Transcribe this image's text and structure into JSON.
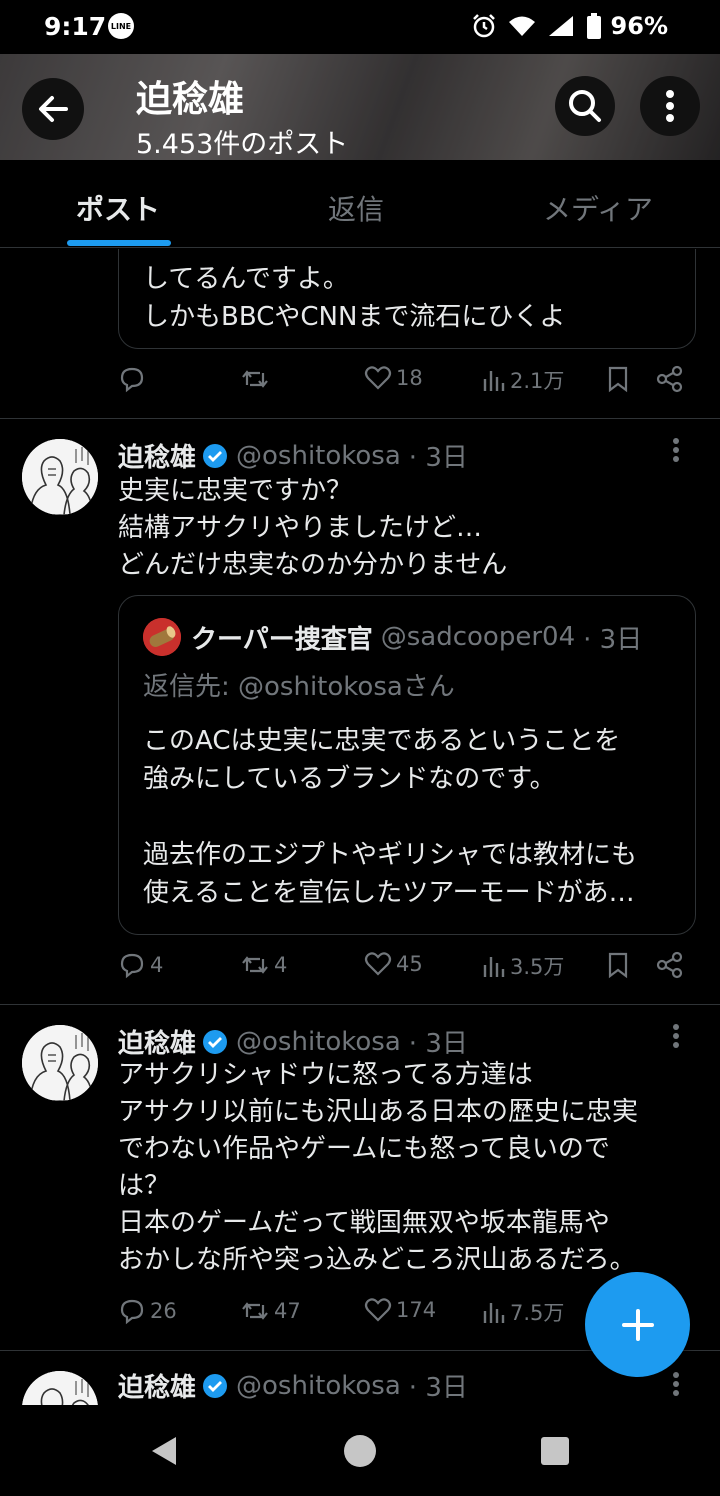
{
  "status_bar": {
    "time": "9:17",
    "line_app": "LINE",
    "battery": "96%"
  },
  "header": {
    "title": "迫稔雄",
    "post_count": "5.453件のポスト"
  },
  "tabs": [
    {
      "label": "ポスト",
      "active": true
    },
    {
      "label": "返信",
      "active": false
    },
    {
      "label": "メディア",
      "active": false
    }
  ],
  "tweets": [
    {
      "quote_tail": "してるんですよ。\nしかもBBCやCNNまで流石にひくよ",
      "actions": {
        "replies": "",
        "retweets": "",
        "likes": "18",
        "views": "2.1万"
      }
    },
    {
      "name": "迫稔雄",
      "handle": "@oshitokosa",
      "time": "· 3日",
      "text": "史実に忠実ですか？\n結構アサクリやりましたけど…\nどんだけ忠実なのか分かりません",
      "quote": {
        "name": "クーパー捜査官",
        "handle": "@sadcooper04",
        "time": "· 3日",
        "reply_to": "返信先: @oshitokosaさん",
        "text": "このACは史実に忠実であるということを\n強みにしているブランドなのです。\n\n過去作のエジプトやギリシャでは教材にも\n使えることを宣伝したツアーモードがあ…"
      },
      "actions": {
        "replies": "4",
        "retweets": "4",
        "likes": "45",
        "views": "3.5万"
      }
    },
    {
      "name": "迫稔雄",
      "handle": "@oshitokosa",
      "time": "· 3日",
      "text": "アサクリシャドウに怒ってる方達は\nアサクリ以前にも沢山ある日本の歴史に忠実\nでわない作品やゲームにも怒って良いので\nは？\n日本のゲームだって戦国無双や坂本龍馬や\nおかしな所や突っ込みどころ沢山あるだろ。",
      "actions": {
        "replies": "26",
        "retweets": "47",
        "likes": "174",
        "views": "7.5万"
      }
    },
    {
      "name": "迫稔雄",
      "handle": "@oshitokosa",
      "time": "· 3日"
    }
  ],
  "colors": {
    "accent": "#1d9bf0",
    "background": "#000000",
    "text": "#e7e9ea",
    "muted": "#71767b",
    "border": "#2f3336"
  }
}
